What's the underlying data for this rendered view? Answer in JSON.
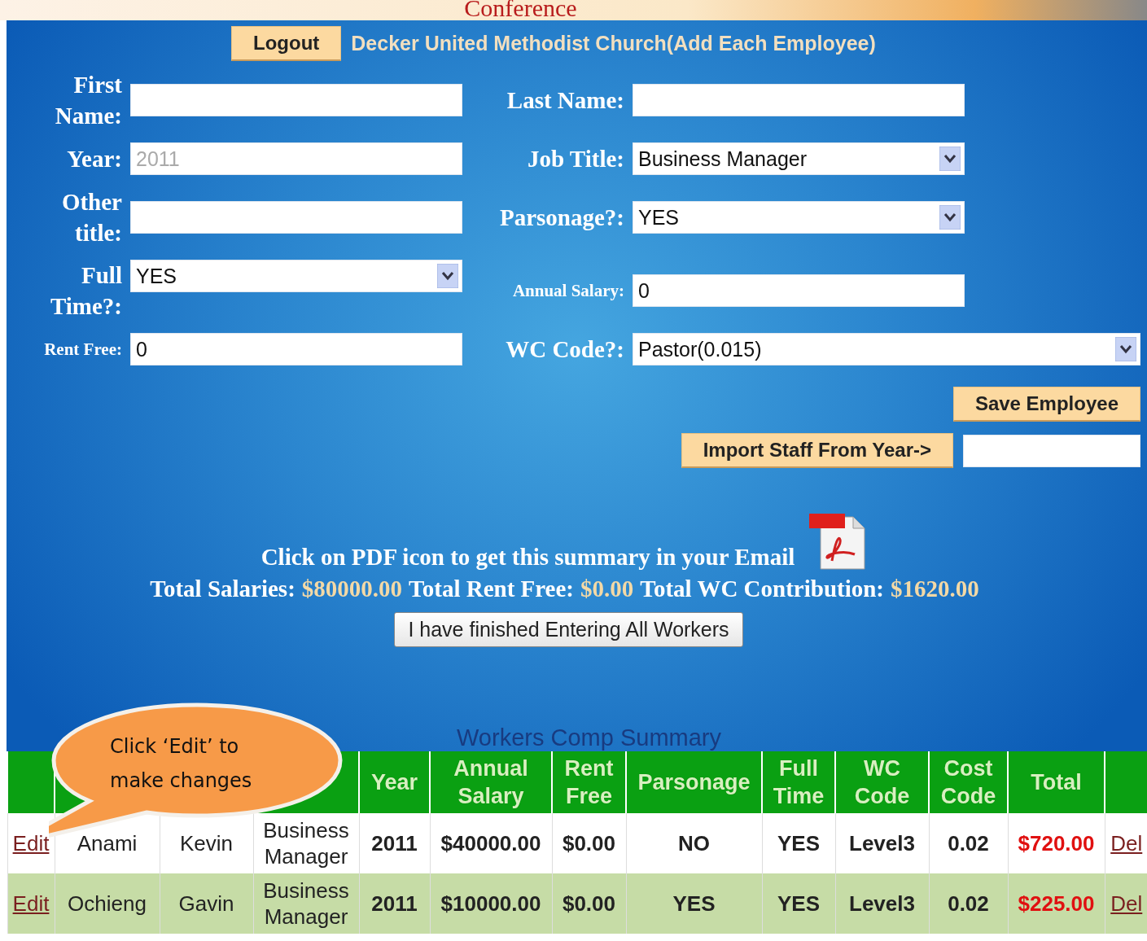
{
  "banner": {
    "title": "Conference"
  },
  "header": {
    "logout": "Logout",
    "church": "Decker United Methodist Church(Add Each Employee)"
  },
  "form": {
    "rows": [
      {
        "left": {
          "label": "First Name:",
          "kind": "text",
          "two_line": true
        },
        "right": {
          "label": "Last Name:",
          "kind": "text"
        }
      },
      {
        "left": {
          "label": "Year:",
          "kind": "text",
          "placeholder": "2011"
        },
        "right": {
          "label": "Job Title:",
          "kind": "select",
          "value": "Business Manager"
        }
      },
      {
        "left": {
          "label": "Other title:",
          "kind": "text",
          "two_line": true
        },
        "right": {
          "label": "Parsonage?:",
          "kind": "select",
          "value": "YES"
        }
      },
      {
        "left": {
          "label": "Full Time?:",
          "kind": "select",
          "value": "YES",
          "two_line": true
        },
        "right": {
          "label": "Annual Salary:",
          "kind": "text",
          "value": "0",
          "small": true
        }
      },
      {
        "left": {
          "label": "Rent Free:",
          "kind": "text",
          "value": "0",
          "small": true
        },
        "right": {
          "label": "WC Code?:",
          "kind": "select",
          "value": "Pastor(0.015)",
          "wide": true
        }
      }
    ]
  },
  "save_button": "Save Employee",
  "import_button": "Import Staff From Year->",
  "pdf_note": "Click on PDF icon to get this summary in your Email",
  "totals": [
    {
      "label": "Total Salaries:",
      "value": "$80000.00"
    },
    {
      "label": "Total Rent Free:",
      "value": "$0.00"
    },
    {
      "label": "Total WC Contribution:",
      "value": "$1620.00"
    }
  ],
  "finish_button": "I have finished Entering All Workers",
  "table": {
    "caption": "Workers Comp Summary",
    "columns": [
      {},
      {},
      {},
      {},
      {
        "label": "Year"
      },
      {
        "label": "Annual Salary"
      },
      {
        "label": "Rent Free"
      },
      {
        "label": "Parsonage"
      },
      {
        "label": "Full Time"
      },
      {
        "label": "WC Code"
      },
      {
        "label": "Cost Code"
      },
      {
        "label": "Total"
      },
      {}
    ],
    "rows": [
      {
        "edit": "Edit",
        "last": "Anami",
        "first": "Kevin",
        "job": "Business Manager",
        "year": "2011",
        "salary": "$40000.00",
        "rent": "$0.00",
        "parsonage": "NO",
        "full_time": "YES",
        "wc": "Level3",
        "cost": "0.02",
        "total": "$720.00",
        "del": "Del"
      },
      {
        "edit": "Edit",
        "last": "Ochieng",
        "first": "Gavin",
        "job": "Business Manager",
        "year": "2011",
        "salary": "$10000.00",
        "rent": "$0.00",
        "parsonage": "YES",
        "full_time": "YES",
        "wc": "Level3",
        "cost": "0.02",
        "total": "$225.00",
        "del": "Del"
      }
    ]
  },
  "callout": "Click ‘Edit’ to make changes"
}
